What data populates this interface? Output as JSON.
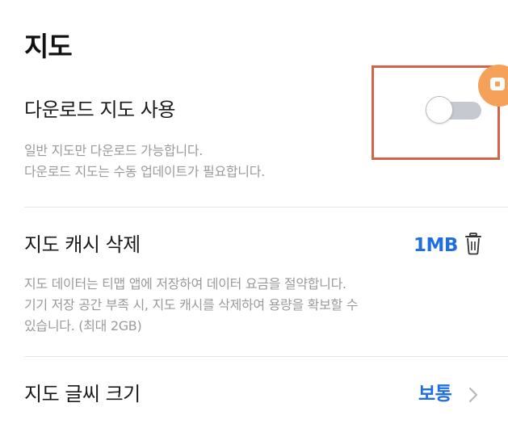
{
  "header": {
    "title": "지도"
  },
  "download_map": {
    "label": "다운로드 지도 사용",
    "toggle_state": "off",
    "description": [
      "일반 지도만 다운로드 가능합니다.",
      "다운로드 지도는 수동 업데이트가 필요합니다."
    ]
  },
  "clear_cache": {
    "label": "지도 캐시 삭제",
    "size": "1MB",
    "icon": "trash-icon",
    "description": [
      "지도 데이터는 티맵 앱에 저장하여 데이터 요금을 절약합니다.",
      "기기 저장 공간 부족 시, 지도 캐시를 삭제하여 용량을 확보할 수",
      "있습니다. (최대 2GB)"
    ]
  },
  "font_size": {
    "label": "지도 글씨 크기",
    "value": "보통",
    "icon": "chevron-right-icon"
  },
  "colors": {
    "accent": "#1f6fe0",
    "highlight": "#d2644a",
    "badge": "#f6a15a",
    "toggle_off": "#c6c9cf"
  }
}
